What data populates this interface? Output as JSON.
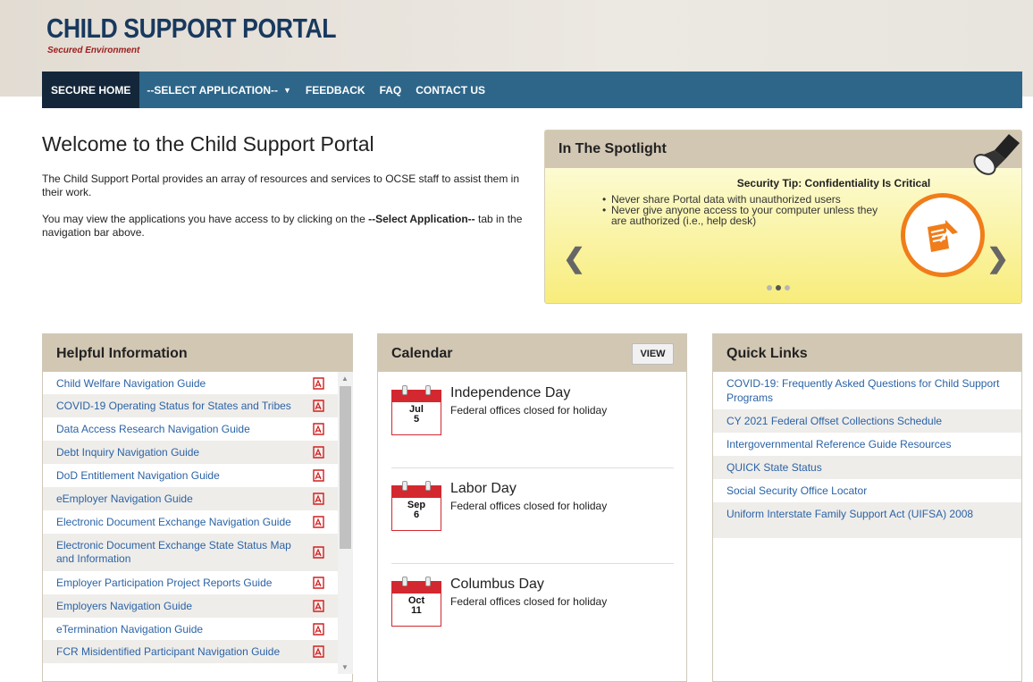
{
  "header": {
    "title": "CHILD SUPPORT PORTAL",
    "subtitle": "Secured Environment"
  },
  "nav": {
    "items": [
      {
        "label": "SECURE HOME"
      },
      {
        "label": "--SELECT APPLICATION--"
      },
      {
        "label": "FEEDBACK"
      },
      {
        "label": "FAQ"
      },
      {
        "label": "CONTACT US"
      }
    ],
    "dropdown_glyph": "▼"
  },
  "welcome": {
    "title": "Welcome to the Child Support Portal",
    "para1": "The Child Support Portal provides an array of resources and services to OCSE staff to assist them in their work.",
    "para2_prefix": "You may view the applications you have access to by clicking on the ",
    "para2_bold": "--Select Application--",
    "para2_suffix": " tab in the navigation bar above."
  },
  "spotlight": {
    "heading": "In The Spotlight",
    "tip_title": "Security Tip: Confidentiality Is Critical",
    "bullets": [
      "Never share Portal data with unauthorized users",
      "Never give anyone access to your computer unless they are authorized (i.e., help desk)"
    ],
    "prev_glyph": "❮",
    "next_glyph": "❯",
    "icon": "document-pin-icon",
    "slide_count": 3,
    "active_slide": 2
  },
  "helpful": {
    "heading": "Helpful Information",
    "items": [
      {
        "label": "Child Welfare Navigation Guide"
      },
      {
        "label": "COVID-19 Operating Status for States and Tribes"
      },
      {
        "label": "Data Access Research Navigation Guide"
      },
      {
        "label": "Debt Inquiry Navigation Guide"
      },
      {
        "label": "DoD Entitlement Navigation Guide"
      },
      {
        "label": "eEmployer Navigation Guide"
      },
      {
        "label": "Electronic Document Exchange Navigation Guide"
      },
      {
        "label": "Electronic Document Exchange State Status Map and Information"
      },
      {
        "label": "Employer Participation Project Reports Guide"
      },
      {
        "label": "Employers Navigation Guide"
      },
      {
        "label": "eTermination Navigation Guide"
      },
      {
        "label": "FCR Misidentified Participant Navigation Guide"
      }
    ],
    "icon": "pdf-icon",
    "scroll_up_glyph": "▲",
    "scroll_down_glyph": "▼"
  },
  "calendar": {
    "heading": "Calendar",
    "view_label": "VIEW",
    "events": [
      {
        "month": "Jul",
        "day": "5",
        "title": "Independence Day",
        "desc": "Federal offices closed for holiday"
      },
      {
        "month": "Sep",
        "day": "6",
        "title": "Labor Day",
        "desc": "Federal offices closed for holiday"
      },
      {
        "month": "Oct",
        "day": "11",
        "title": "Columbus Day",
        "desc": "Federal offices closed for holiday"
      }
    ]
  },
  "quick_links": {
    "heading": "Quick Links",
    "items": [
      {
        "label": "COVID-19: Frequently Asked Questions for Child Support Programs"
      },
      {
        "label": "CY 2021 Federal Offset Collections Schedule"
      },
      {
        "label": "Intergovernmental Reference Guide Resources"
      },
      {
        "label": "QUICK State Status"
      },
      {
        "label": "Social Security Office Locator"
      },
      {
        "label": "Uniform Interstate Family Support Act (UIFSA) 2008"
      }
    ]
  },
  "colors": {
    "nav_bg": "#2e6689",
    "nav_active": "#14273a",
    "logo_blue": "#18395e",
    "logo_red": "#9c1c1c",
    "link": "#2b63a6",
    "panel_header": "#d2c7b3",
    "spot_orange": "#f07d1a",
    "cal_red": "#d32830"
  }
}
